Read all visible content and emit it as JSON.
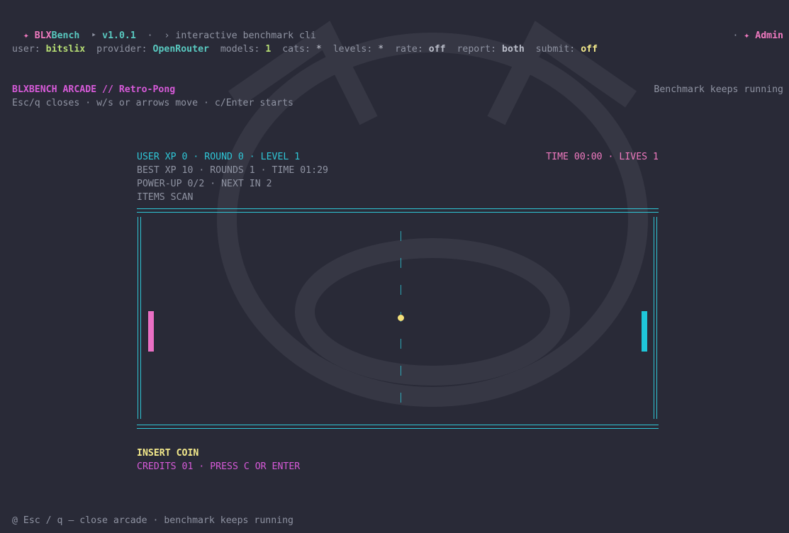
{
  "header": {
    "star": "✦",
    "brand_a": "BLX",
    "brand_b": "Bench",
    "arrow": "‣",
    "version": "v1.0.1",
    "dot": "·",
    "tagline": "› interactive benchmark cli",
    "admin_dot": "·",
    "admin_star": "✦",
    "admin": "Admin"
  },
  "status": {
    "user_label": "user:",
    "user": "bitslix",
    "provider_label": "provider:",
    "provider": "OpenRouter",
    "models_label": "models:",
    "models": "1",
    "cats_label": "cats:",
    "cats": "*",
    "levels_label": "levels:",
    "levels": "*",
    "rate_label": "rate:",
    "rate": "off",
    "report_label": "report:",
    "report": "both",
    "submit_label": "submit:",
    "submit": "off"
  },
  "arcade": {
    "title": "BLXBENCH ARCADE // Retro-Pong",
    "help": "Esc/q closes · w/s or arrows move · c/Enter starts",
    "running": "Benchmark keeps running"
  },
  "hud": {
    "stats": "USER XP 0 · ROUND 0 · LEVEL 1",
    "time_lives": "TIME 00:00 · LIVES 1",
    "best": "BEST XP 10 · ROUNDS 1 · TIME 01:29",
    "powerup": "POWER-UP 0/2 · NEXT IN 2",
    "items": "ITEMS SCAN"
  },
  "coin": {
    "insert": "INSERT COIN",
    "credits": "CREDITS 01 · PRESS C OR ENTER"
  },
  "footer": {
    "text": "@ Esc / q — close arcade · benchmark keeps running"
  },
  "colors": {
    "background": "#292a37",
    "accent_pink": "#f07ac0",
    "accent_cyan": "#2fc6d6",
    "accent_magenta": "#d65ad8",
    "accent_yellow": "#f3e98b",
    "accent_green": "#b6dd74",
    "left_paddle": "#ea6fc4",
    "right_paddle": "#1fc6d9",
    "ball": "#f3e07a"
  }
}
